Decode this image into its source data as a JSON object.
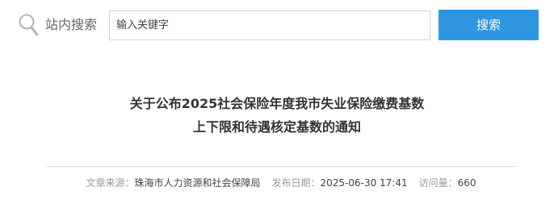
{
  "search": {
    "label": "站内搜索",
    "placeholder": "输入关键字",
    "button_label": "搜索"
  },
  "article": {
    "title_line1": "关于公布2025社会保险年度我市失业保险缴费基数",
    "title_line2": "上下限和待遇核定基数的通知",
    "meta": {
      "source_label": "文章来源：",
      "source_value": "珠海市人力资源和社会保障局",
      "date_label": "发布日期：",
      "date_value": "2025-06-30 17:41",
      "views_label": "访问量：",
      "views_value": "660"
    }
  },
  "colors": {
    "accent": "#2e96e0",
    "divider": "#d8d8d8",
    "meta_text": "#999999"
  },
  "icons": [
    "search-icon"
  ]
}
